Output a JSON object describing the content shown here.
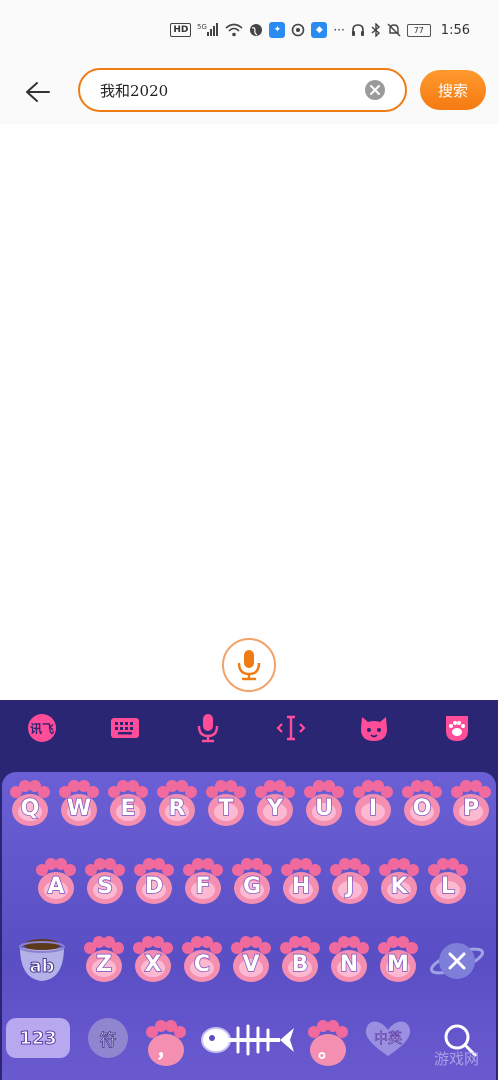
{
  "status_bar": {
    "hd": "HD",
    "network": "5G",
    "battery": "77",
    "time": "1:56"
  },
  "search": {
    "query": "我和2020",
    "button_label": "搜索"
  },
  "keyboard": {
    "rows": [
      [
        "Q",
        "W",
        "E",
        "R",
        "T",
        "Y",
        "U",
        "I",
        "O",
        "P"
      ],
      [
        "A",
        "S",
        "D",
        "F",
        "G",
        "H",
        "J",
        "K",
        "L"
      ],
      [
        "Z",
        "X",
        "C",
        "V",
        "B",
        "N",
        "M"
      ]
    ],
    "ab_label": "ab",
    "num_label": "123",
    "symbol_label": "符",
    "lang_label": "中英",
    "comma_label": "，",
    "period_label": "。"
  },
  "watermark": "游戏网",
  "colors": {
    "accent": "#f07a14",
    "keyboard_bg": "#2a2673",
    "paw_pink": "#f48fb1"
  }
}
